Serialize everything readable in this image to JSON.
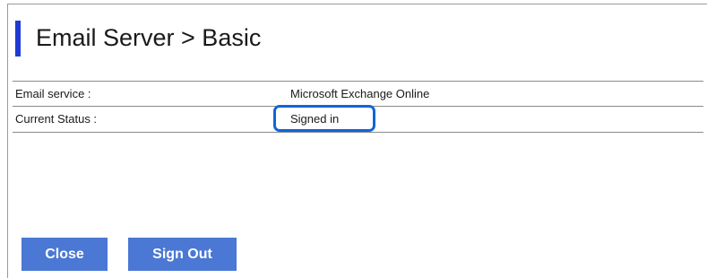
{
  "page": {
    "title": "Email Server > Basic"
  },
  "fields": [
    {
      "label": "Email service :",
      "value": "Microsoft Exchange Online"
    },
    {
      "label": "Current Status :",
      "value": "Signed in"
    }
  ],
  "buttons": {
    "close_label": "Close",
    "sign_out_label": "Sign Out"
  },
  "colors": {
    "accent": "#1f3bd6",
    "button_bg": "#4a78d4",
    "highlight": "#1264d8"
  }
}
